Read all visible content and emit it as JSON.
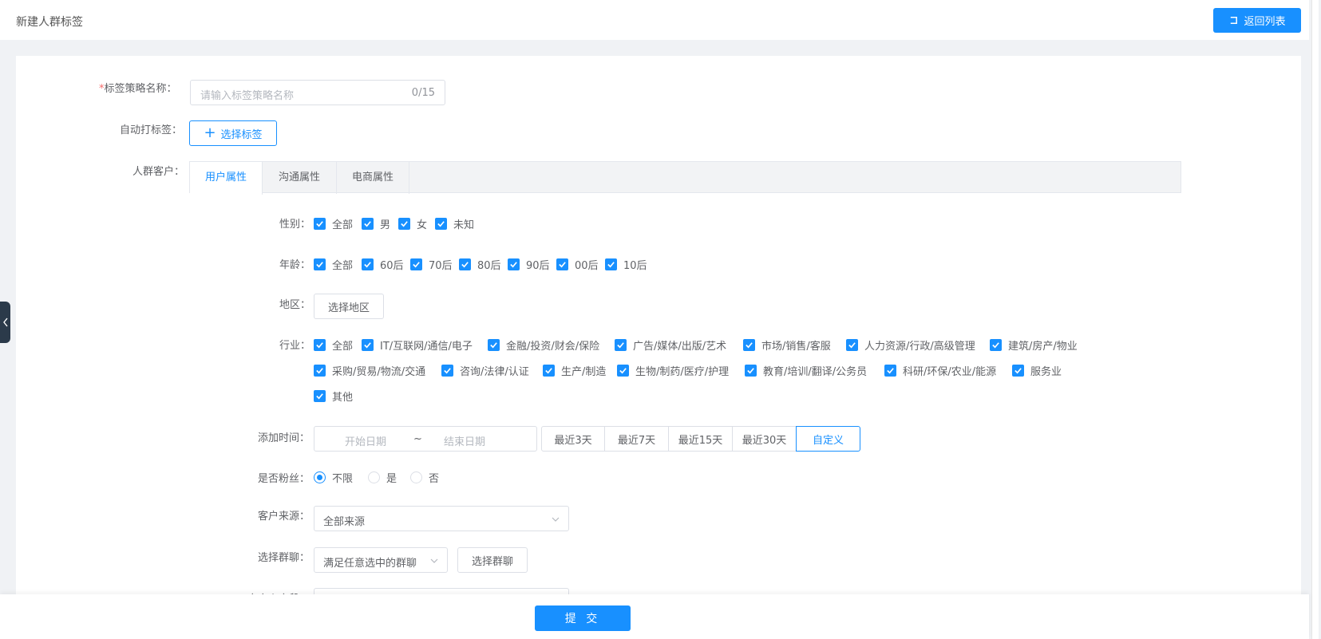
{
  "header": {
    "title": "新建人群标签",
    "back_label": "返回列表"
  },
  "form": {
    "name": {
      "required_mark": "*",
      "label": "标签策略名称：",
      "placeholder": "请输入标签策略名称",
      "counter": "0/15"
    },
    "auto_tag": {
      "label": "自动打标签：",
      "button_label": "选择标签"
    },
    "crowd": {
      "label": "人群客户："
    }
  },
  "tabs": [
    {
      "label": "用户属性",
      "active": true
    },
    {
      "label": "沟通属性",
      "active": false
    },
    {
      "label": "电商属性",
      "active": false
    }
  ],
  "gender": {
    "label": "性别：",
    "options": [
      "全部",
      "男",
      "女",
      "未知"
    ]
  },
  "age": {
    "label": "年龄：",
    "options": [
      "全部",
      "60后",
      "70后",
      "80后",
      "90后",
      "00后",
      "10后"
    ]
  },
  "region": {
    "label": "地区：",
    "button_label": "选择地区"
  },
  "industry": {
    "label": "行业：",
    "options": [
      "全部",
      "IT/互联网/通信/电子",
      "金融/投资/财会/保险",
      "广告/媒体/出版/艺术",
      "市场/销售/客服",
      "人力资源/行政/高级管理",
      "建筑/房产/物业",
      "采购/贸易/物流/交通",
      "咨询/法律/认证",
      "生产/制造",
      "生物/制药/医疗/护理",
      "教育/培训/翻译/公务员",
      "科研/环保/农业/能源",
      "服务业",
      "其他"
    ]
  },
  "add_time": {
    "label": "添加时间：",
    "start_placeholder": "开始日期",
    "separator": "~",
    "end_placeholder": "结束日期",
    "ranges": [
      "最近3天",
      "最近7天",
      "最近15天",
      "最近30天",
      "自定义"
    ],
    "active_range": "自定义"
  },
  "fans": {
    "label": "是否粉丝：",
    "options": [
      "不限",
      "是",
      "否"
    ],
    "selected": "不限"
  },
  "source": {
    "label": "客户来源：",
    "value": "全部来源"
  },
  "group_chat": {
    "label": "选择群聊：",
    "mode": "满足任意选中的群聊",
    "button_label": "选择群聊"
  },
  "custom_field": {
    "label": "自定义字段："
  },
  "footer": {
    "submit_label": "提 交"
  },
  "colors": {
    "primary": "#1890ff",
    "required": "#f56c6c"
  }
}
